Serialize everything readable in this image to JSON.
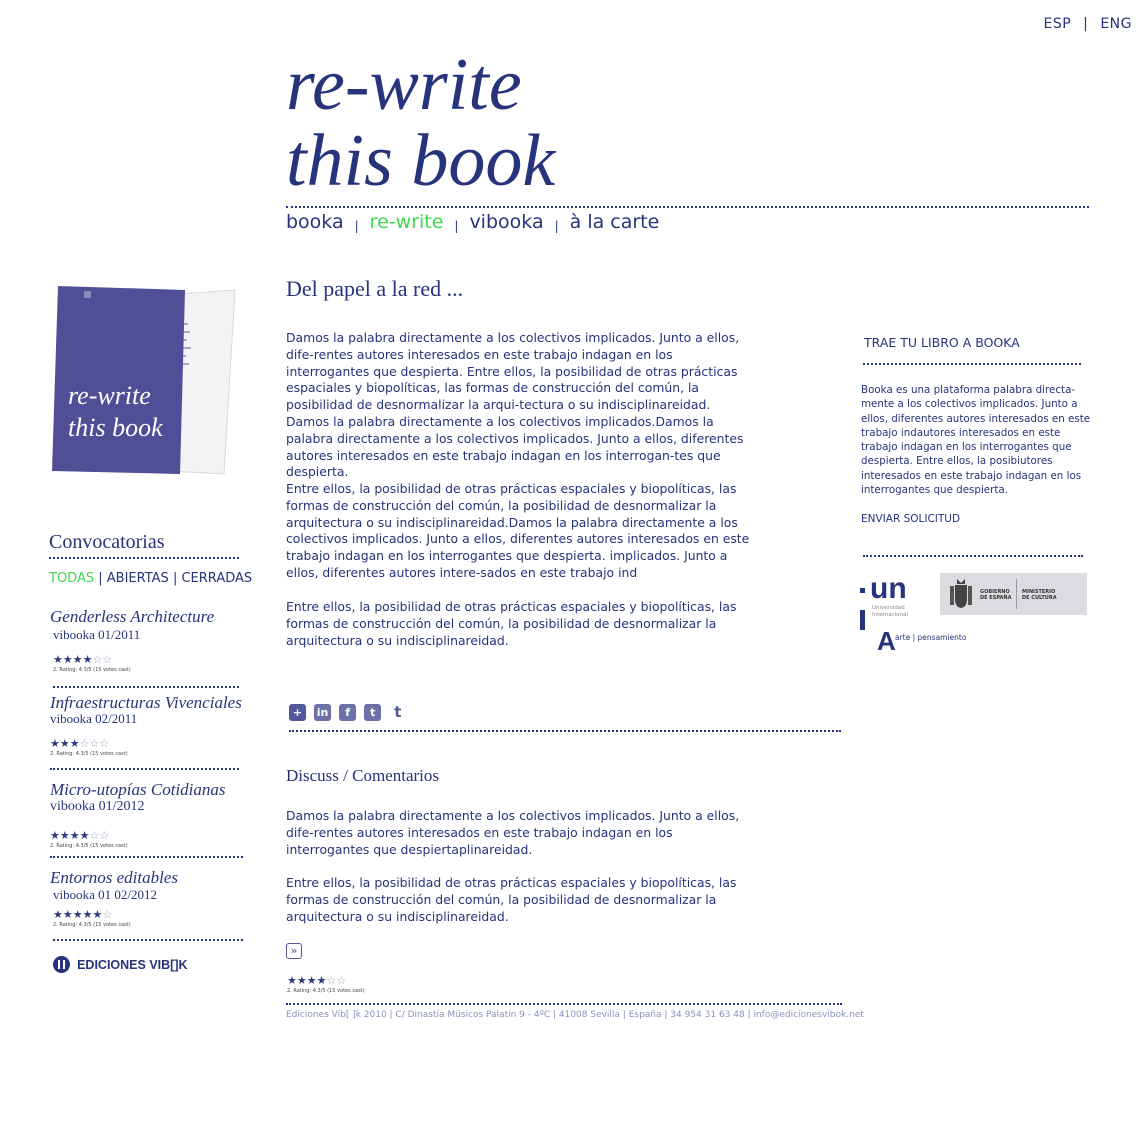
{
  "header": {
    "languages": [
      "ESP",
      "ENG"
    ],
    "lang_separator": "|",
    "title_line1": "re-write",
    "title_line2": "this book"
  },
  "nav": {
    "items": [
      "booka",
      "re-write",
      "vibooka",
      "à la carte"
    ],
    "active": "re-write",
    "separator": "|"
  },
  "cover": {
    "title_line1": "re-write",
    "title_line2": "this book"
  },
  "sidebar": {
    "title": "Convocatorias",
    "filters": [
      "TODAS",
      "ABIERTAS",
      "CERRADAS"
    ],
    "active_filter": "TODAS",
    "filter_separator": "|",
    "items": [
      {
        "title": "Genderless Architecture",
        "subtitle": "vibooka 01/2011",
        "stars": 4,
        "rating_text": "2. Rating: 4.3/5 (15 votes cast)"
      },
      {
        "title": "Infraestructuras Vivenciales",
        "subtitle": "vibooka 02/2011",
        "stars": 3,
        "rating_text": "2. Rating: 4.3/5 (15 votes cast)"
      },
      {
        "title": "Micro-utopías Cotidianas",
        "subtitle": "vibooka 01/2012",
        "stars": 4,
        "rating_text": "2. Rating: 4.3/5 (15 votes cast)"
      },
      {
        "title": "Entornos editables",
        "subtitle": "vibooka 01 02/2012",
        "stars": 5,
        "rating_text": "2. Rating: 4.3/5 (15 votes cast)"
      }
    ],
    "logo_text": "EDICIONES VIB[]K"
  },
  "main": {
    "section_title": "Del papel a la red ...",
    "paragraphs": [
      "Damos la palabra directamente a los colectivos implicados. Junto a ellos, dife-rentes autores interesados en este trabajo indagan en los interrogantes que despierta. Entre ellos, la posibilidad de otras prácticas espaciales y biopolíticas, las formas de construcción del común, la posibilidad de desnormalizar la arqui-tectura o su indisciplinareidad. Damos la palabra directamente a los colectivos implicados.Damos la palabra directamente a los colectivos implicados. Junto a ellos, diferentes autores interesados en este trabajo indagan en los interrogan-tes que despierta.",
      "Entre ellos, la posibilidad de otras prácticas espaciales y biopolíticas, las formas de construcción del común, la posibilidad de desnormalizar la arquitectura o su indisciplinareidad.Damos la palabra directamente a los colectivos implicados. Junto a ellos, diferentes autores interesados en este trabajo indagan en los interrogantes que despierta. implicados. Junto a ellos, diferentes autores intere-sados en este trabajo ind",
      "Entre ellos, la posibilidad de otras prácticas espaciales y biopolíticas, las formas de construcción del común, la posibilidad de desnormalizar la arquitectura o su indisciplinareidad."
    ],
    "share_icons": [
      "add-icon",
      "linkedin-icon",
      "facebook-icon",
      "tumblr-icon",
      "twitter-icon"
    ],
    "discuss_title": "Discuss / Comentarios",
    "discuss_paragraphs": [
      "Damos la palabra directamente a los colectivos implicados. Junto a ellos, dife-rentes autores interesados en este trabajo indagan en los interrogantes que despiertaplinareidad.",
      "Entre ellos, la posibilidad de otras prácticas espaciales y biopolíticas, las formas de construcción del común, la posibilidad de desnormalizar la arquitectura o su indisciplinareidad."
    ],
    "discuss_stars": 4,
    "discuss_rating_text": "2. Rating: 4.3/5 (15 votes cast)",
    "footer": "Ediciones Vib[ ]k 2010 | C/ Dinastía Músicos Palatín 9 - 4ºC | 41008 Sevilla | España | 34 954 31 63 48 | info@edicionesvibok.net"
  },
  "right": {
    "title": "TRAE TU LIBRO A BOOKA",
    "text": "Booka es una plataforma palabra directa-mente a los colectivos implicados. Junto a ellos, diferentes autores interesados en este trabajo indautores interesados en este trabajo indagan en los interrogantes que despierta. Entre ellos, la posibiutores interesados en este trabajo indagan en los interrogantes que despierta.",
    "link": "ENVIAR SOLICITUD",
    "logo_unia_text": "un",
    "logo_unia_sub": "Universidad Internacional",
    "logo_unia_a": "A",
    "logo_unia_arte": "arte | pensamiento",
    "logo_gov_left": "GOBIERNO DE ESPAÑA",
    "logo_gov_right": "MINISTERIO DE CULTURA"
  },
  "colors": {
    "primary": "#27337a",
    "active": "#3ed84a",
    "cover": "#4f4e96",
    "footer": "#8a93bd"
  }
}
